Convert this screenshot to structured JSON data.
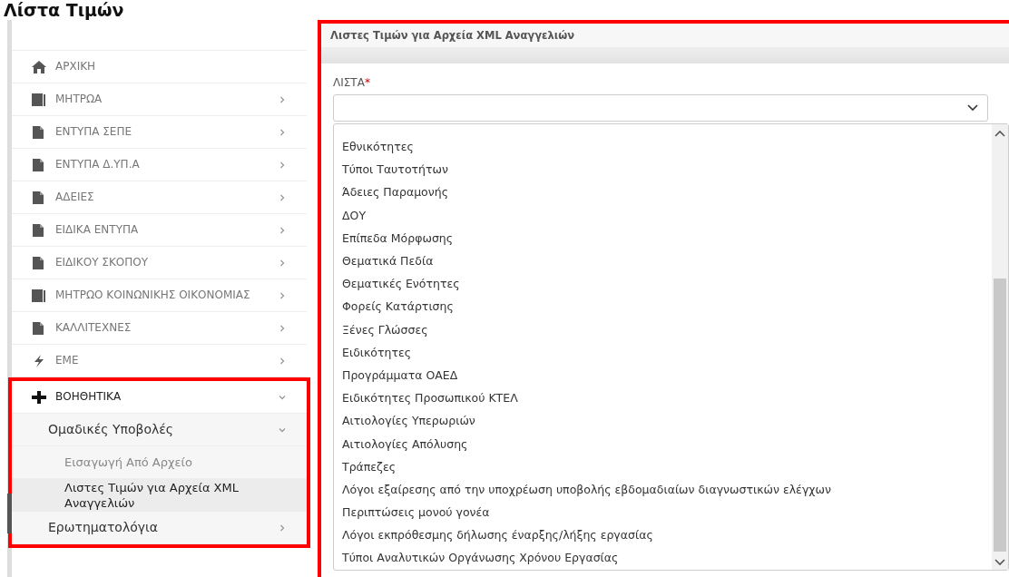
{
  "page_title": "Λίστα Τιμών",
  "sidebar": {
    "items": [
      {
        "label": "ΑΡΧΙΚΗ",
        "kind": "home",
        "group": false,
        "expanded": false,
        "selected": false
      },
      {
        "label": "ΜΗΤΡΩΑ",
        "kind": "registry",
        "group": true,
        "expanded": false,
        "selected": false
      },
      {
        "label": "ΕΝΤΥΠΑ ΣΕΠΕ",
        "kind": "form",
        "group": true,
        "expanded": false,
        "selected": false
      },
      {
        "label": "ΕΝΤΥΠΑ Δ.ΥΠ.Α",
        "kind": "form",
        "group": true,
        "expanded": false,
        "selected": false
      },
      {
        "label": "ΑΔΕΙΕΣ",
        "kind": "form",
        "group": true,
        "expanded": false,
        "selected": false
      },
      {
        "label": "ΕΙΔΙΚΑ ΕΝΤΥΠΑ",
        "kind": "form",
        "group": true,
        "expanded": false,
        "selected": false
      },
      {
        "label": "ΕΙΔΙΚΟΥ ΣΚΟΠΟΥ",
        "kind": "form",
        "group": true,
        "expanded": false,
        "selected": false
      },
      {
        "label": "ΜΗΤΡΩΟ ΚΟΙΝΩΝΙΚΗΣ ΟΙΚΟΝΟΜΙΑΣ",
        "kind": "registry",
        "group": true,
        "expanded": false,
        "selected": false
      },
      {
        "label": "ΚΑΛΛΙΤΕΧΝΕΣ",
        "kind": "form",
        "group": true,
        "expanded": false,
        "selected": false
      },
      {
        "label": "ΕΜΕ",
        "kind": "energy",
        "group": true,
        "expanded": false,
        "selected": false
      },
      {
        "label": "ΒΟΗΘΗΤΙΚΑ",
        "kind": "tools",
        "group": true,
        "expanded": true,
        "selected": false,
        "children": [
          {
            "label": "Ομαδικές Υποβολές",
            "group": true,
            "expanded": true,
            "selected": false,
            "children": [
              {
                "label": "Εισαγωγή Από Αρχείο",
                "group": false,
                "expanded": false,
                "selected": false
              },
              {
                "label": "Λιστες Τιμών για Αρχεία XML Αναγγελιών",
                "group": false,
                "expanded": false,
                "selected": true
              }
            ]
          },
          {
            "label": "Ερωτηματολόγια",
            "group": true,
            "expanded": false,
            "selected": false
          }
        ]
      }
    ]
  },
  "panel": {
    "title": "Λιστες Τιμών για Αρχεία XML Αναγγελιών",
    "field": {
      "label": "ΛΙΣΤΑ",
      "required_mark": "*"
    },
    "options": [
      {
        "label": "Εθνικότητες",
        "selected": false
      },
      {
        "label": "Τύποι Ταυτοτήτων",
        "selected": false
      },
      {
        "label": "Άδειες Παραμονής",
        "selected": false
      },
      {
        "label": "ΔΟΥ",
        "selected": false
      },
      {
        "label": "Επίπεδα Μόρφωσης",
        "selected": false
      },
      {
        "label": "Θεματικά Πεδία",
        "selected": false
      },
      {
        "label": "Θεματικές Ενότητες",
        "selected": false
      },
      {
        "label": "Φορείς Κατάρτισης",
        "selected": false
      },
      {
        "label": "Ξένες Γλώσσες",
        "selected": false
      },
      {
        "label": "Ειδικότητες",
        "selected": false
      },
      {
        "label": "Προγράμματα ΟΑΕΔ",
        "selected": false
      },
      {
        "label": "Ειδικότητες Προσωπικού ΚΤΕΛ",
        "selected": false
      },
      {
        "label": "Αιτιολογίες Υπερωριών",
        "selected": false
      },
      {
        "label": "Αιτιολογίες Απόλυσης",
        "selected": false
      },
      {
        "label": "Τράπεζες",
        "selected": false
      },
      {
        "label": "Λόγοι εξαίρεσης από την υποχρέωση υποβολής εβδομαδιαίων διαγνωστικών ελέγχων",
        "selected": false
      },
      {
        "label": "Περιπτώσεις μονού γονέα",
        "selected": false
      },
      {
        "label": "Λόγοι εκπρόθεσμης δήλωσης έναρξης/λήξης εργασίας",
        "selected": false
      },
      {
        "label": "Τύποι Αναλυτικών Οργάνωσης Χρόνου Εργασίας",
        "selected": false
      }
    ]
  }
}
